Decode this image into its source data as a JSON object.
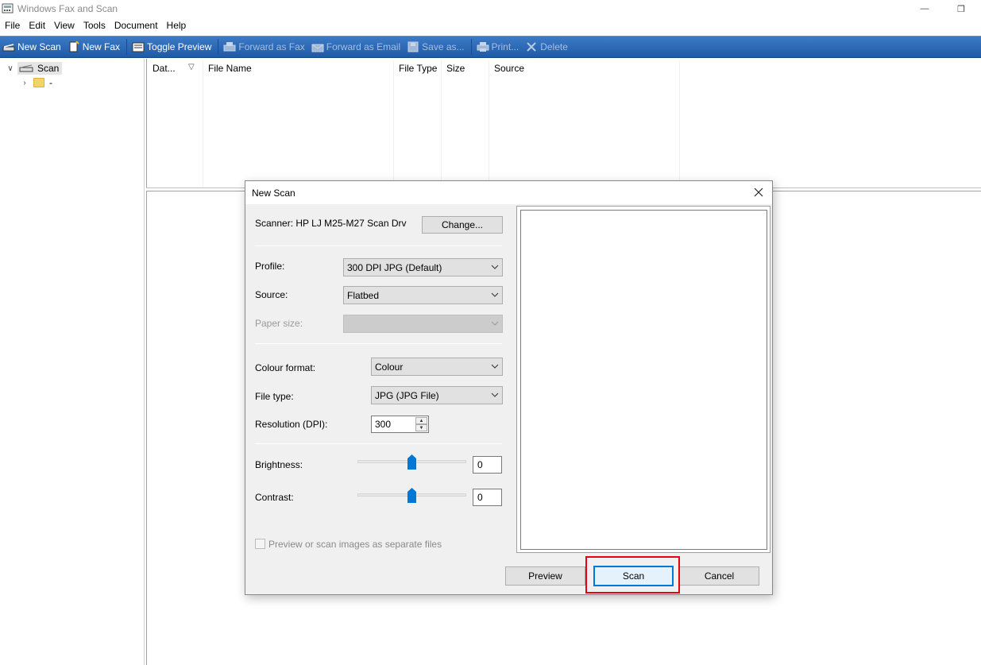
{
  "window": {
    "title": "Windows Fax and Scan",
    "minimize_glyph": "—",
    "restore_glyph": "❐"
  },
  "menu": [
    "File",
    "Edit",
    "View",
    "Tools",
    "Document",
    "Help"
  ],
  "toolbar": {
    "new_scan": "New Scan",
    "new_fax": "New Fax",
    "toggle_preview": "Toggle Preview",
    "forward_fax": "Forward as Fax",
    "forward_email": "Forward as Email",
    "save_as": "Save as...",
    "print": "Print...",
    "delete": "Delete"
  },
  "tree": {
    "root_label": "Scan",
    "child_label": "-"
  },
  "list": {
    "columns": [
      "Dat...",
      "File Name",
      "File Type",
      "Size",
      "Source"
    ]
  },
  "dialog": {
    "title": "New Scan",
    "scanner_label": "Scanner: HP LJ M25-M27 Scan Drv",
    "change_button": "Change...",
    "profile_label": "Profile:",
    "profile_value": "300 DPI JPG (Default)",
    "source_label": "Source:",
    "source_value": "Flatbed",
    "paper_size_label": "Paper size:",
    "paper_size_value": "",
    "colour_format_label": "Colour format:",
    "colour_format_value": "Colour",
    "file_type_label": "File type:",
    "file_type_value": "JPG (JPG File)",
    "resolution_label": "Resolution (DPI):",
    "resolution_value": "300",
    "brightness_label": "Brightness:",
    "brightness_value": "0",
    "contrast_label": "Contrast:",
    "contrast_value": "0",
    "separate_files_label": "Preview or scan images as separate files",
    "preview_button": "Preview",
    "scan_button": "Scan",
    "cancel_button": "Cancel"
  },
  "colors": {
    "toolbar_blue": "#2a66b3",
    "focus_blue": "#0078d7",
    "highlight_red": "#e8000d",
    "slider_thumb": "#0078d7"
  }
}
